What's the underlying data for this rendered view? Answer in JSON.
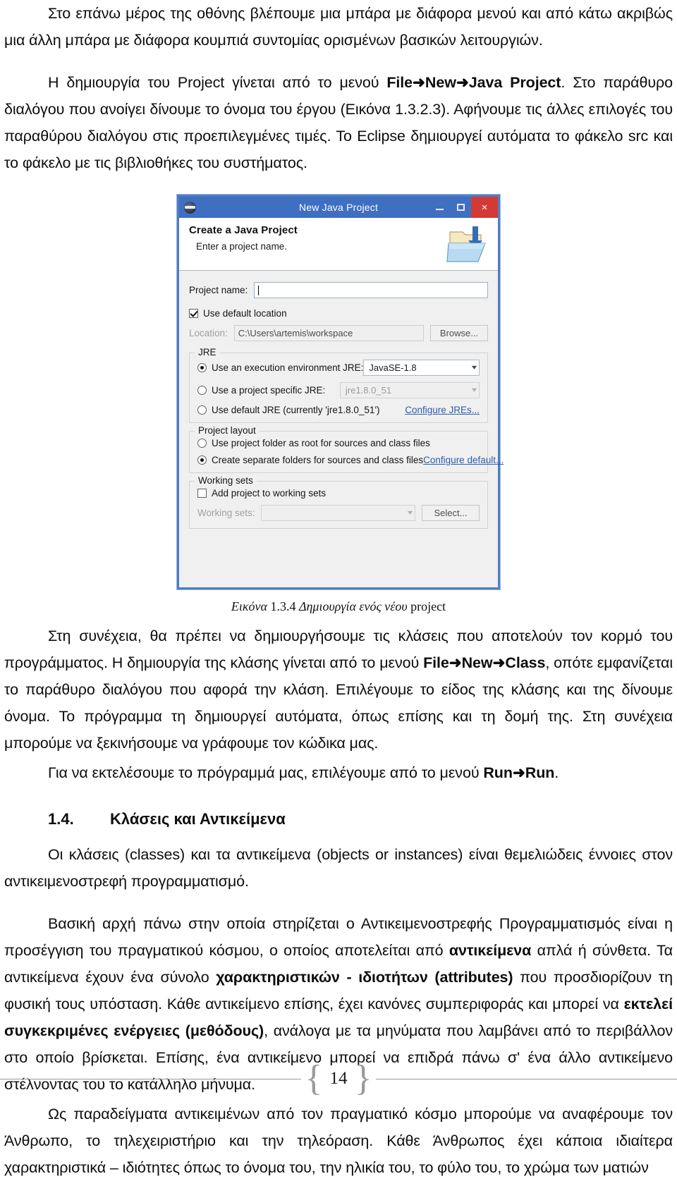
{
  "document": {
    "page_number": "14",
    "paragraphs": [
      {
        "id": "p1",
        "runs": [
          {
            "text": "Στο επάνω μέρος της οθόνης βλέπουμε μια μπάρα με διάφορα μενού  και από κάτω ακριβώς μια άλλη μπάρα με διάφορα κουμπιά συντομίας ορισμένων βασικών λειτουργιών.",
            "bold": false
          }
        ]
      },
      {
        "id": "p2",
        "runs": [
          {
            "text": "Η δημιουργία του Project γίνεται από το μενού ",
            "bold": false
          },
          {
            "text": "File➜New➜Java Project",
            "bold": true
          },
          {
            "text": ". Στο παράθυρο διαλόγου που ανοίγει δίνουμε το όνομα του έργου (Εικόνα 1.3.2.3). Αφήνουμε τις άλλες επιλογές του παραθύρου διαλόγου στις προεπιλεγμένες τιμές. Το Eclipse δημιουργεί αυτόματα το φάκελο src και το φάκελο με τις βιβλιοθήκες του συστήματος.",
            "bold": false
          }
        ]
      },
      {
        "id": "p3",
        "runs": [
          {
            "text": "Στη συνέχεια, θα πρέπει να δημιουργήσουμε τις κλάσεις που αποτελούν τον κορμό του προγράμματος. Η δημιουργία της κλάσης γίνεται από το μενού ",
            "bold": false
          },
          {
            "text": "File➜New➜Class",
            "bold": true
          },
          {
            "text": ", οπότε εμφανίζεται το παράθυρο διαλόγου που αφορά την κλάση. Επιλέγουμε το είδος της κλάσης και της δίνουμε όνομα. Το πρόγραμμα τη δημιουργεί αυτόματα, όπως επίσης και τη δομή της. Στη συνέχεια μπορούμε να ξεκινήσουμε να γράφουμε τον κώδικα μας.",
            "bold": false
          }
        ]
      },
      {
        "id": "p4",
        "runs": [
          {
            "text": "Για να εκτελέσουμε το πρόγραμμά μας, επιλέγουμε από το μενού ",
            "bold": false
          },
          {
            "text": "Run➜Run",
            "bold": true
          },
          {
            "text": ".",
            "bold": false
          }
        ]
      },
      {
        "id": "p5",
        "runs": [
          {
            "text": "Οι κλάσεις (classes) και τα αντικείμενα (objects or instances) είναι θεμελιώδεις έννοιες στον αντικειμενοστρεφή προγραμματισμό.",
            "bold": false
          }
        ]
      },
      {
        "id": "p6",
        "runs": [
          {
            "text": "Βασική αρχή πάνω στην οποία στηρίζεται ο Αντικειμενοστρεφής Προγραμματισμός είναι η προσέγγιση του πραγματικού κόσμου, ο οποίος αποτελείται από ",
            "bold": false
          },
          {
            "text": "αντικείμενα",
            "bold": true
          },
          {
            "text": " απλά ή σύνθετα. Τα αντικείμενα έχουν ένα σύνολο ",
            "bold": false
          },
          {
            "text": "χαρακτηριστικών - ιδιοτήτων (attributes)",
            "bold": true
          },
          {
            "text": " που προσδιορίζουν τη φυσική τους υπόσταση.  Κάθε αντικείμενο επίσης, έχει κανόνες συμπεριφοράς και μπορεί να ",
            "bold": false
          },
          {
            "text": "εκτελεί συγκεκριμένες ενέργειες (μεθόδους)",
            "bold": true
          },
          {
            "text": ", ανάλογα με τα μηνύματα που λαμβάνει από το περιβάλλον στο οποίο βρίσκεται. Επίσης, ένα αντικείμενο μπορεί να επιδρά πάνω σ' ένα άλλο αντικείμενο στέλνοντας του το κατάλληλο μήνυμα.",
            "bold": false
          }
        ]
      },
      {
        "id": "p7",
        "runs": [
          {
            "text": "Ως παραδείγματα αντικειμένων από τον πραγματικό κόσμο μπορούμε να αναφέρουμε τον Άνθρωπο,   το τηλεχειριστήριο και την τηλεόραση. Κάθε Άνθρωπος έχει κάποια ιδιαίτερα χαρακτηριστικά – ιδιότητες όπως το όνομα του, την ηλικία του, το φύλο του, το χρώμα των ματιών",
            "bold": false
          }
        ]
      }
    ],
    "heading": {
      "number": "1.4.",
      "text": "Κλάσεις και Αντικείμενα"
    },
    "figure_caption": {
      "label": "Εικόνα",
      "number": "1.3.4",
      "italic_text": "Δημιουργία ενός νέου",
      "trailing": "project"
    }
  },
  "dialog": {
    "titlebar": {
      "title": "New Java Project",
      "minimize_label": "",
      "maximize_label": "",
      "close_label": "×",
      "icon": "eclipse-icon",
      "bg_color": "#3f6fc1",
      "close_color": "#d33a36"
    },
    "header": {
      "title": "Create a Java Project",
      "subtitle": "Enter a project name.",
      "icon": "new-java-project-folder-icon"
    },
    "project_name": {
      "label": "Project name:",
      "value": "",
      "placeholder": ""
    },
    "use_default_location": {
      "label": "Use default location",
      "checked": true
    },
    "location": {
      "label": "Location:",
      "value": "C:\\Users\\artemis\\workspace",
      "browse_label": "Browse...",
      "disabled": true
    },
    "jre_group": {
      "title": "JRE",
      "options": [
        {
          "label": "Use an execution environment JRE:",
          "selected": true,
          "combo_value": "JavaSE-1.8",
          "combo_disabled": false
        },
        {
          "label": "Use a project specific JRE:",
          "selected": false,
          "combo_value": "jre1.8.0_51",
          "combo_disabled": true
        },
        {
          "label": "Use default JRE (currently 'jre1.8.0_51')",
          "selected": false,
          "link": "Configure JREs..."
        }
      ]
    },
    "project_layout_group": {
      "title": "Project layout",
      "options": [
        {
          "label": "Use project folder as root for sources and class files",
          "selected": false
        },
        {
          "label": "Create separate folders for sources and class files",
          "selected": true,
          "link": "Configure default..."
        }
      ]
    },
    "working_sets_group": {
      "title": "Working sets",
      "add_checkbox": {
        "label": "Add project to working sets",
        "checked": false
      },
      "working_sets_label": "Working sets:",
      "working_sets_value": "",
      "select_label": "Select...",
      "disabled": true
    }
  },
  "footer": {
    "left_brace": "{",
    "right_brace": "}",
    "page_number": "14"
  }
}
